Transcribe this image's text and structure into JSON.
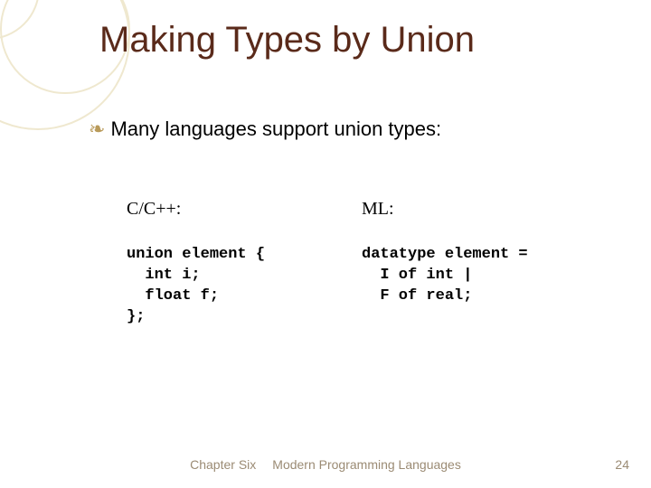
{
  "title": "Making Types by Union",
  "bullet": "Many languages support union types:",
  "left": {
    "label": "C/C++:",
    "code": "union element {\n  int i;\n  float f;\n};"
  },
  "right": {
    "label": "ML:",
    "code": "datatype element =\n  I of int |\n  F of real;"
  },
  "footer": {
    "chapter": "Chapter Six",
    "book": "Modern Programming Languages",
    "page": "24"
  }
}
